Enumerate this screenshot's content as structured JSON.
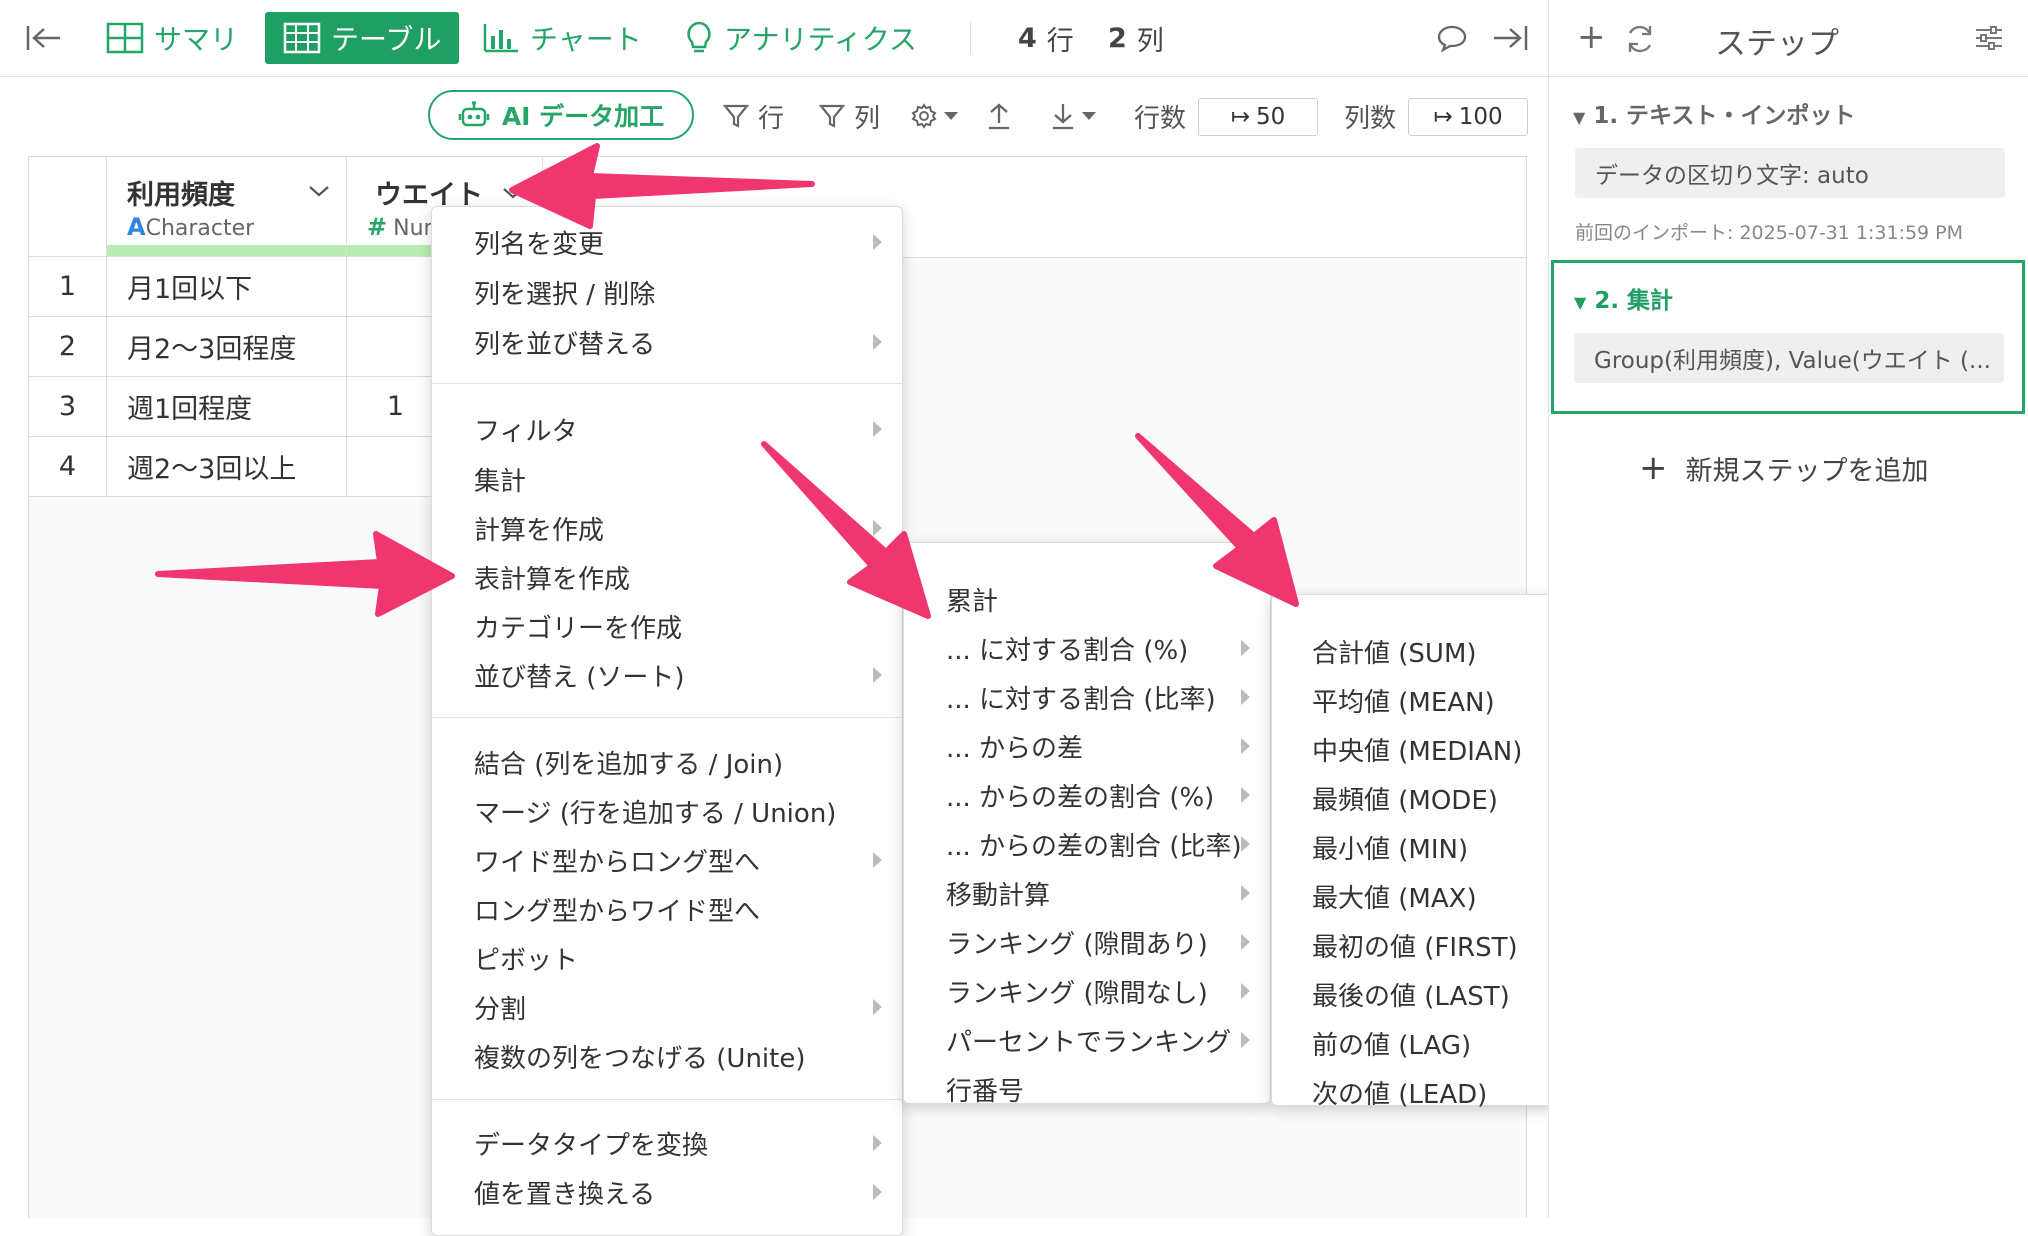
{
  "topbar": {
    "tabs": [
      {
        "label": "サマリ"
      },
      {
        "label": "テーブル"
      },
      {
        "label": "チャート"
      },
      {
        "label": "アナリティクス"
      }
    ],
    "rows_count": "4",
    "rows_unit": "行",
    "cols_count": "2",
    "cols_unit": "列"
  },
  "toolbar": {
    "ai_label": "AI データ加工",
    "filter_row": "行",
    "filter_col": "列",
    "rows_label": "行数",
    "rows_value": "50",
    "cols_label": "列数",
    "cols_value": "100"
  },
  "table": {
    "columns": [
      {
        "name": "利用頻度",
        "type": "Character",
        "type_glyph": "A"
      },
      {
        "name": "ウエイト",
        "type": "Nume",
        "type_glyph": "#"
      }
    ],
    "rows": [
      {
        "index": "1",
        "c1": "月1回以下",
        "c2": ""
      },
      {
        "index": "2",
        "c1": "月2〜3回程度",
        "c2": ""
      },
      {
        "index": "3",
        "c1": "週1回程度",
        "c2": "1"
      },
      {
        "index": "4",
        "c1": "週2〜3回以上",
        "c2": ""
      }
    ]
  },
  "menu1": {
    "items": [
      "列名を変更",
      "列を選択 / 削除",
      "列を並び替える",
      "フィルタ",
      "集計",
      "計算を作成",
      "表計算を作成",
      "カテゴリーを作成",
      "並び替え (ソート)",
      "結合 (列を追加する / Join)",
      "マージ (行を追加する / Union)",
      "ワイド型からロング型へ",
      "ロング型からワイド型へ",
      "ピボット",
      "分割",
      "複数の列をつなげる (Unite)",
      "データタイプを変換",
      "値を置き換える"
    ]
  },
  "menu2": {
    "items": [
      "累計",
      "... に対する割合 (%)",
      "... に対する割合 (比率)",
      "... からの差",
      "... からの差の割合 (%)",
      "... からの差の割合 (比率)",
      "移動計算",
      "ランキング (隙間あり)",
      "ランキング (隙間なし)",
      "パーセントでランキング",
      "行番号"
    ]
  },
  "menu3": {
    "items": [
      "合計値 (SUM)",
      "平均値 (MEAN)",
      "中央値 (MEDIAN)",
      "最頻値 (MODE)",
      "最小値 (MIN)",
      "最大値 (MAX)",
      "最初の値 (FIRST)",
      "最後の値 (LAST)",
      "前の値 (LAG)",
      "次の値 (LEAD)"
    ]
  },
  "steps": {
    "title": "ステップ",
    "step1_title": "1. テキスト・インポット",
    "step1_pill": "データの区切り文字: auto",
    "step1_meta": "前回のインポート: 2025-07-31 1:31:59 PM",
    "step2_title": "2. 集計",
    "step2_pill": "Group(利用頻度), Value(ウエイト (...",
    "add_step": "新規ステップを追加"
  },
  "colors": {
    "accent": "#1f9f63",
    "arrow": "#f0366f"
  }
}
